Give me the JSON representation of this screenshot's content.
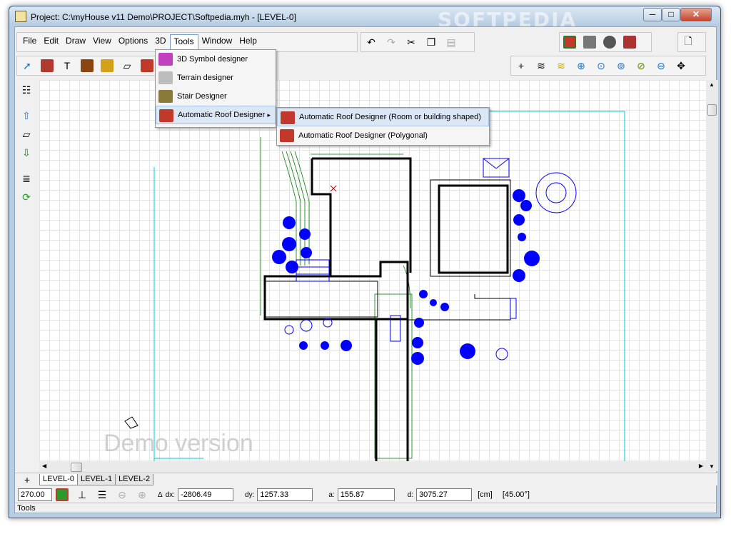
{
  "window": {
    "title": "Project: C:\\myHouse v11 Demo\\PROJECT\\Softpedia.myh - [LEVEL-0]",
    "watermark": "SOFTPEDIA",
    "minimize": "─",
    "maximize": "□",
    "close": "✕"
  },
  "menu": {
    "items": [
      "File",
      "Edit",
      "Draw",
      "View",
      "Options",
      "3D",
      "Tools",
      "Window",
      "Help"
    ]
  },
  "tools_menu": {
    "items": [
      "3D Symbol designer",
      "Terrain designer",
      "Stair Designer",
      "Automatic Roof Designer"
    ],
    "submenu_arrow": "▸"
  },
  "roof_submenu": {
    "items": [
      "Automatic Roof Designer (Room or building shaped)",
      "Automatic Roof Designer (Polygonal)"
    ]
  },
  "canvas": {
    "demo_text": "Demo version"
  },
  "tabs": {
    "add": "+",
    "levels": [
      "LEVEL-0",
      "LEVEL-1",
      "LEVEL-2"
    ]
  },
  "coords": {
    "angle": "270.00",
    "dx_label": "dx:",
    "dx": "-2806.49",
    "dy_label": "dy:",
    "dy": "1257.33",
    "a_label": "a:",
    "a": "155.87",
    "d_label": "d:",
    "d": "3075.27",
    "unit": "[cm]",
    "angle_display": "[45.00°]",
    "delta": "Δ"
  },
  "status": {
    "text": "Tools"
  },
  "colors": {
    "plan_blue": "#0000ff",
    "plan_green": "#007a00",
    "plan_cyan": "#00c8d8"
  }
}
